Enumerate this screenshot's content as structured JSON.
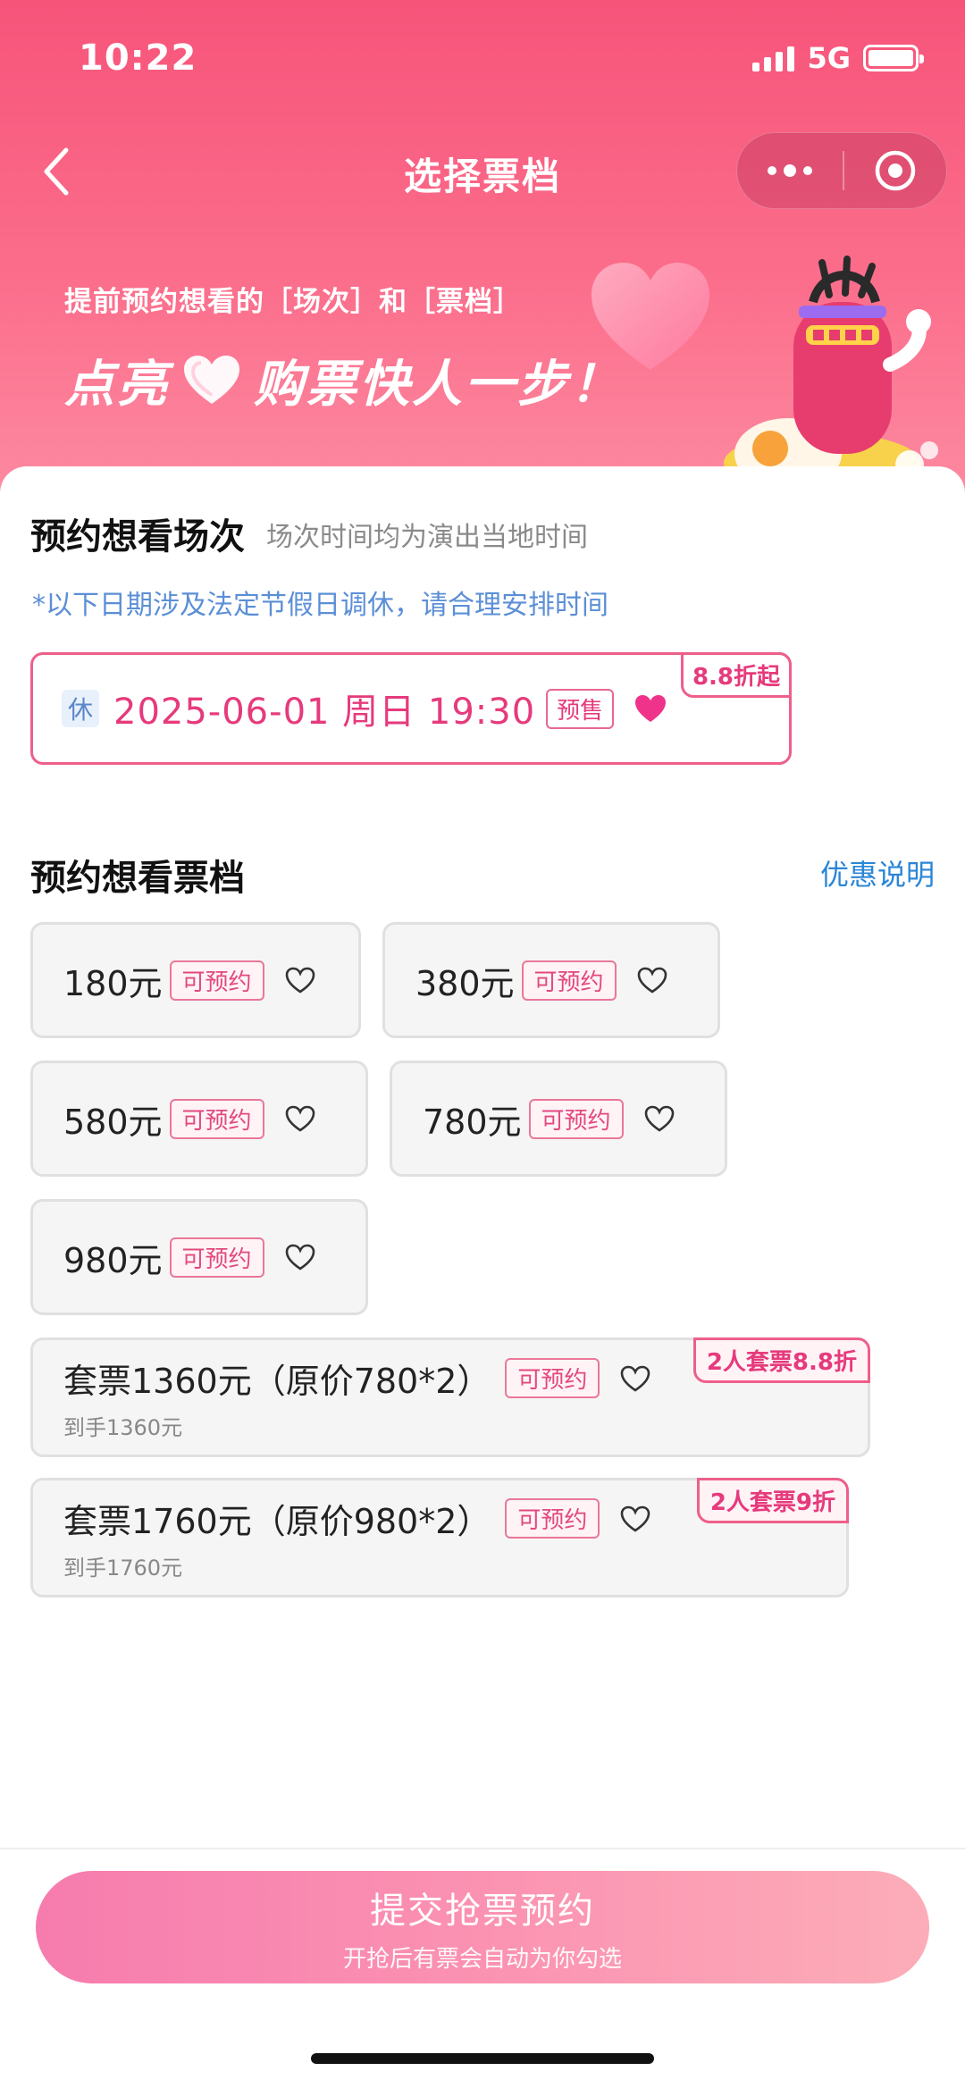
{
  "status": {
    "time": "10:22",
    "network": "5G"
  },
  "nav": {
    "title": "选择票档"
  },
  "banner": {
    "line1": "提前预约想看的［场次］和［票档］",
    "line2_a": "点亮",
    "line2_b": "购票快人一步！"
  },
  "sessions_section": {
    "title": "预约想看场次",
    "subtitle": "场次时间均为演出当地时间",
    "notice": "*以下日期涉及法定节假日调休，请合理安排时间",
    "session": {
      "rest_tag": "休",
      "datetime": "2025-06-01 周日 19:30",
      "status": "预售",
      "discount": "8.8折起"
    }
  },
  "tiers_section": {
    "title": "预约想看票档",
    "link": "优惠说明",
    "tiers": [
      {
        "price": "180元",
        "status": "可预约"
      },
      {
        "price": "380元",
        "status": "可预约"
      },
      {
        "price": "580元",
        "status": "可预约"
      },
      {
        "price": "780元",
        "status": "可预约"
      },
      {
        "price": "980元",
        "status": "可预约"
      }
    ],
    "packages": [
      {
        "price": "套票1360元（原价780*2）",
        "status": "可预约",
        "sub": "到手1360元",
        "tag": "2人套票8.8折"
      },
      {
        "price": "套票1760元（原价980*2）",
        "status": "可预约",
        "sub": "到手1760元",
        "tag": "2人套票9折"
      }
    ]
  },
  "submit": {
    "label": "提交抢票预约",
    "sub": "开抢后有票会自动为你勾选"
  },
  "colors": {
    "brand_pink": "#f7547a",
    "accent": "#e63a7c",
    "link_blue": "#2a86d6"
  }
}
